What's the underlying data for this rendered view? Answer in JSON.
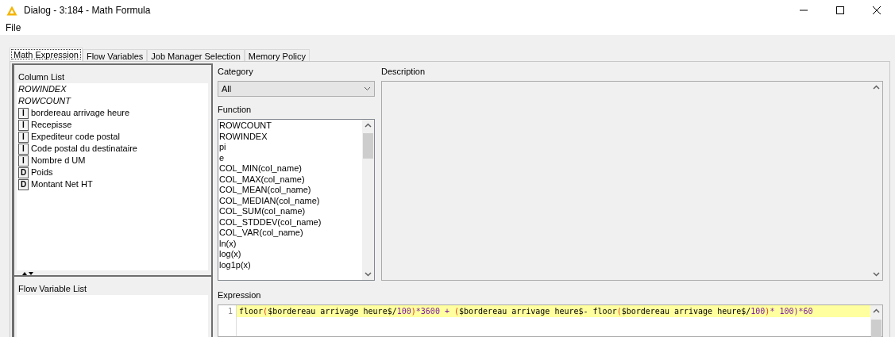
{
  "window": {
    "title": "Dialog - 3:184 - Math Formula"
  },
  "menu": [
    "File"
  ],
  "tabs": [
    {
      "label": "Math Expression",
      "selected": true
    },
    {
      "label": "Flow Variables",
      "selected": false
    },
    {
      "label": "Job Manager Selection",
      "selected": false
    },
    {
      "label": "Memory Policy",
      "selected": false
    }
  ],
  "column_list": {
    "title": "Column List",
    "items": [
      {
        "kind": "special",
        "name": "ROWINDEX"
      },
      {
        "kind": "special",
        "name": "ROWCOUNT"
      },
      {
        "kind": "column",
        "type": "I",
        "name": "bordereau arrivage heure"
      },
      {
        "kind": "column",
        "type": "I",
        "name": "Recepisse"
      },
      {
        "kind": "column",
        "type": "I",
        "name": "Expediteur code postal"
      },
      {
        "kind": "column",
        "type": "I",
        "name": "Code postal du destinataire"
      },
      {
        "kind": "column",
        "type": "I",
        "name": "Nombre d UM"
      },
      {
        "kind": "column",
        "type": "D",
        "name": "Poids"
      },
      {
        "kind": "column",
        "type": "D",
        "name": "Montant Net HT"
      }
    ]
  },
  "flow_variable_list": {
    "title": "Flow Variable List"
  },
  "category": {
    "label": "Category",
    "value": "All"
  },
  "function": {
    "label": "Function",
    "items": [
      "ROWCOUNT",
      "ROWINDEX",
      "pi",
      "e",
      "COL_MIN(col_name)",
      "COL_MAX(col_name)",
      "COL_MEAN(col_name)",
      "COL_MEDIAN(col_name)",
      "COL_SUM(col_name)",
      "COL_STDDEV(col_name)",
      "COL_VAR(col_name)",
      "ln(x)",
      "log(x)",
      "log1p(x)"
    ]
  },
  "description": {
    "label": "Description"
  },
  "expression": {
    "label": "Expression",
    "line_number": "1",
    "tokens": [
      {
        "kind": "text",
        "text": "floor"
      },
      {
        "kind": "paren",
        "text": "("
      },
      {
        "kind": "text",
        "text": "$bordereau arrivage heure$/"
      },
      {
        "kind": "num",
        "text": "100"
      },
      {
        "kind": "paren",
        "text": ")"
      },
      {
        "kind": "num",
        "text": "*3600 + "
      },
      {
        "kind": "paren",
        "text": "("
      },
      {
        "kind": "text",
        "text": "$bordereau arrivage heure$- floor"
      },
      {
        "kind": "paren",
        "text": "("
      },
      {
        "kind": "text",
        "text": "$bordereau arrivage heure$/"
      },
      {
        "kind": "num",
        "text": "100"
      },
      {
        "kind": "paren",
        "text": ")"
      },
      {
        "kind": "num",
        "text": "* 100)*60"
      }
    ]
  }
}
